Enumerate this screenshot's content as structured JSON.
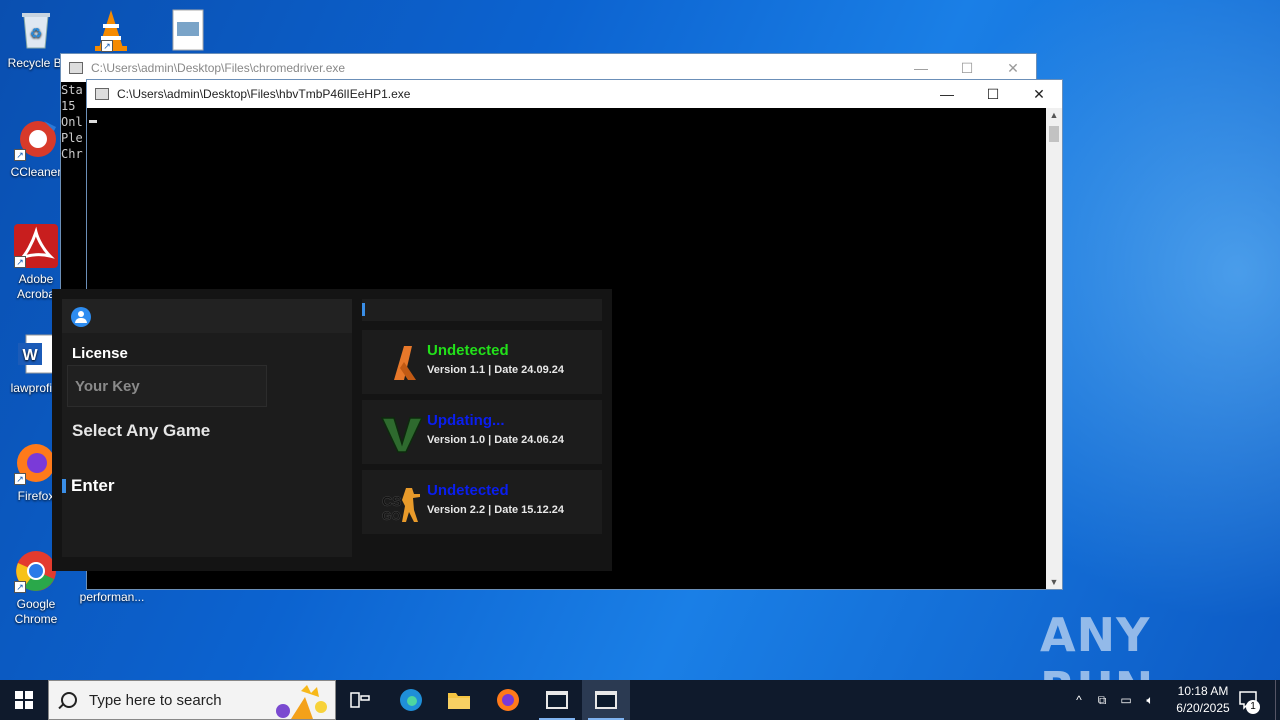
{
  "desktop": {
    "icons": [
      {
        "label": "Recycle Bin",
        "display": "Recycle Bi"
      },
      {
        "label": "CCleaner"
      },
      {
        "label": "Adobe Acrobat",
        "line1": "Adobe",
        "line2": "Acroba"
      },
      {
        "label": "lawprofile",
        "display": "lawprofile"
      },
      {
        "label": "Firefox",
        "display": "Firefox"
      },
      {
        "label": "Google Chrome",
        "line1": "Google",
        "line2": "Chrome"
      },
      {
        "label": "performan...",
        "display": "performan..."
      }
    ],
    "watermark": "ANY RUN"
  },
  "back_window": {
    "title": "C:\\Users\\admin\\Desktop\\Files\\chromedriver.exe",
    "console_lines": [
      "Sta",
      "15",
      "Onl",
      "Ple",
      "Chr"
    ]
  },
  "front_window": {
    "title": "C:\\Users\\admin\\Desktop\\Files\\hbvTmbP46lIEeHP1.exe"
  },
  "app": {
    "license_label": "License",
    "key_placeholder": "Your Key",
    "select_label": "Select Any Game",
    "enter_label": "Enter",
    "games": [
      {
        "name": "fortnite-icon",
        "status": "Undetected",
        "status_color": "#22e01a",
        "version": "Version 1.1 | Date 24.09.24"
      },
      {
        "name": "gta-v-icon",
        "status": "Updating...",
        "status_color": "#0a1ef0",
        "version": "Version 1.0 | Date 24.06.24"
      },
      {
        "name": "csgo-icon",
        "status": "Undetected",
        "status_color": "#0a1ef0",
        "version": "Version 2.2 | Date 15.12.24"
      }
    ]
  },
  "taskbar": {
    "search_placeholder": "Type here to search",
    "time": "10:18 AM",
    "date": "6/20/2025",
    "notification_count": "1"
  }
}
